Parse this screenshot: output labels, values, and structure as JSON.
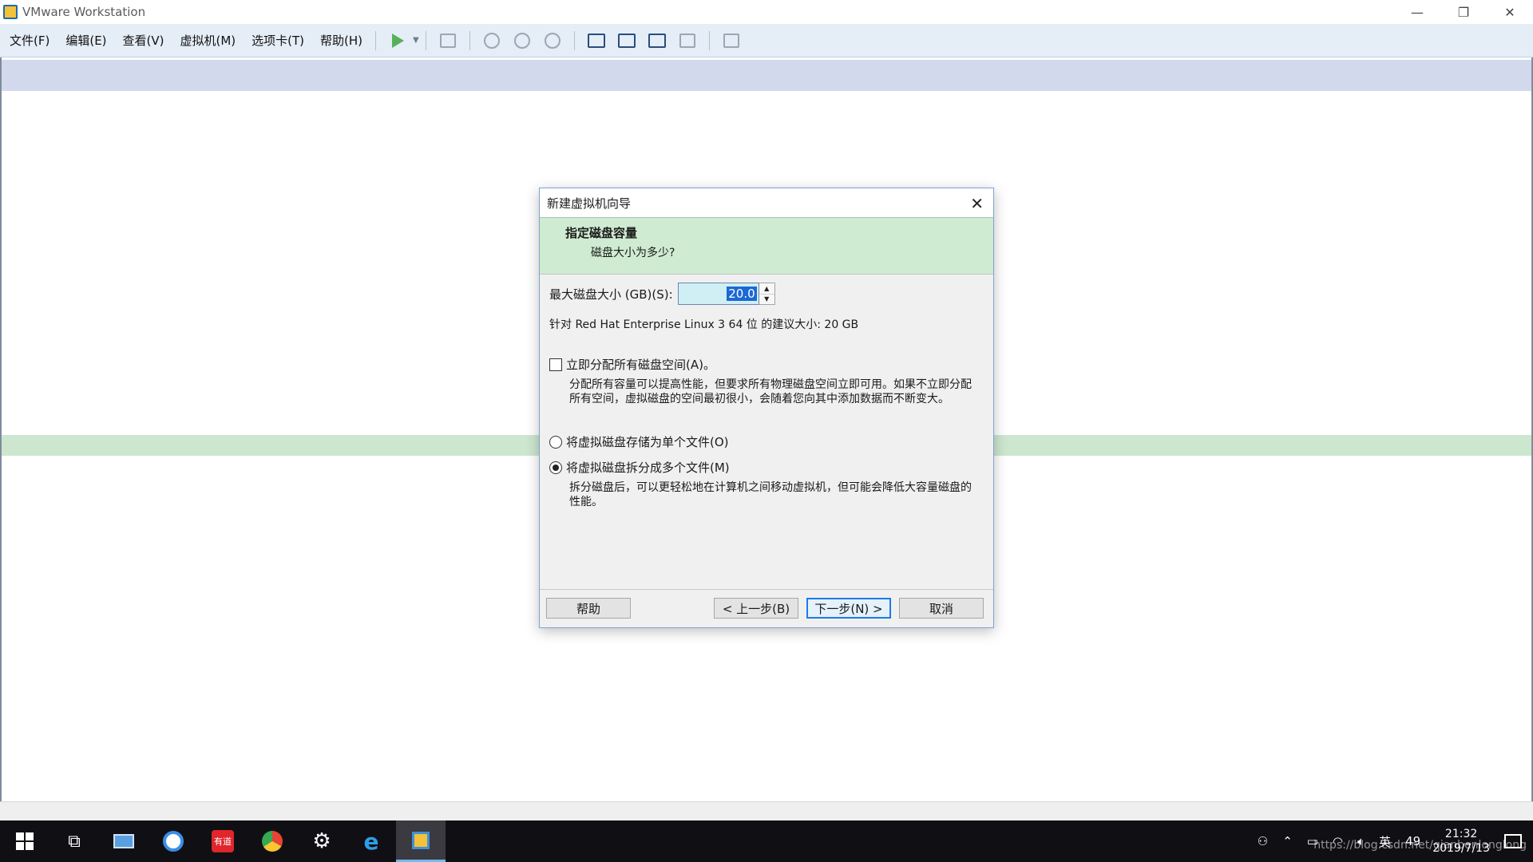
{
  "window": {
    "title": "VMware Workstation"
  },
  "menu": [
    "文件(F)",
    "编辑(E)",
    "查看(V)",
    "虚拟机(M)",
    "选项卡(T)",
    "帮助(H)"
  ],
  "dialog": {
    "title": "新建虚拟机向导",
    "header_title": "指定磁盘容量",
    "header_subtitle": "磁盘大小为多少?",
    "size_label": "最大磁盘大小 (GB)(S):",
    "size_value": "20.0",
    "recommend": "针对 Red Hat Enterprise Linux 3 64 位 的建议大小: 20 GB",
    "allocate_label": "立即分配所有磁盘空间(A)。",
    "allocate_checked": false,
    "allocate_desc": "分配所有容量可以提高性能，但要求所有物理磁盘空间立即可用。如果不立即分配所有空间，虚拟磁盘的空间最初很小，会随着您向其中添加数据而不断变大。",
    "single_file_label": "将虚拟磁盘存储为单个文件(O)",
    "multi_file_label": "将虚拟磁盘拆分成多个文件(M)",
    "selected_option": "multi",
    "split_desc": "拆分磁盘后，可以更轻松地在计算机之间移动虚拟机，但可能会降低大容量磁盘的性能。",
    "buttons": {
      "help": "帮助",
      "back": "< 上一步(B)",
      "next": "下一步(N) >",
      "cancel": "取消"
    }
  },
  "taskbar": {
    "apps": [
      "start-icon",
      "task-view-icon",
      "computer-icon",
      "browser-icon",
      "youdao-icon",
      "chrome-icon",
      "settings-icon",
      "ie-icon",
      "vmware-icon"
    ],
    "youdao_label": "有道",
    "tray": {
      "ime": "英",
      "battery": "49",
      "time": "21:32",
      "date": "2019/7/13"
    },
    "watermark": "https://blog.csdn.net/qianbenlonglong"
  },
  "colors": {
    "accent": "#1e7be6",
    "header_green": "#cfebd2",
    "toolbar": "#e5edf7"
  }
}
